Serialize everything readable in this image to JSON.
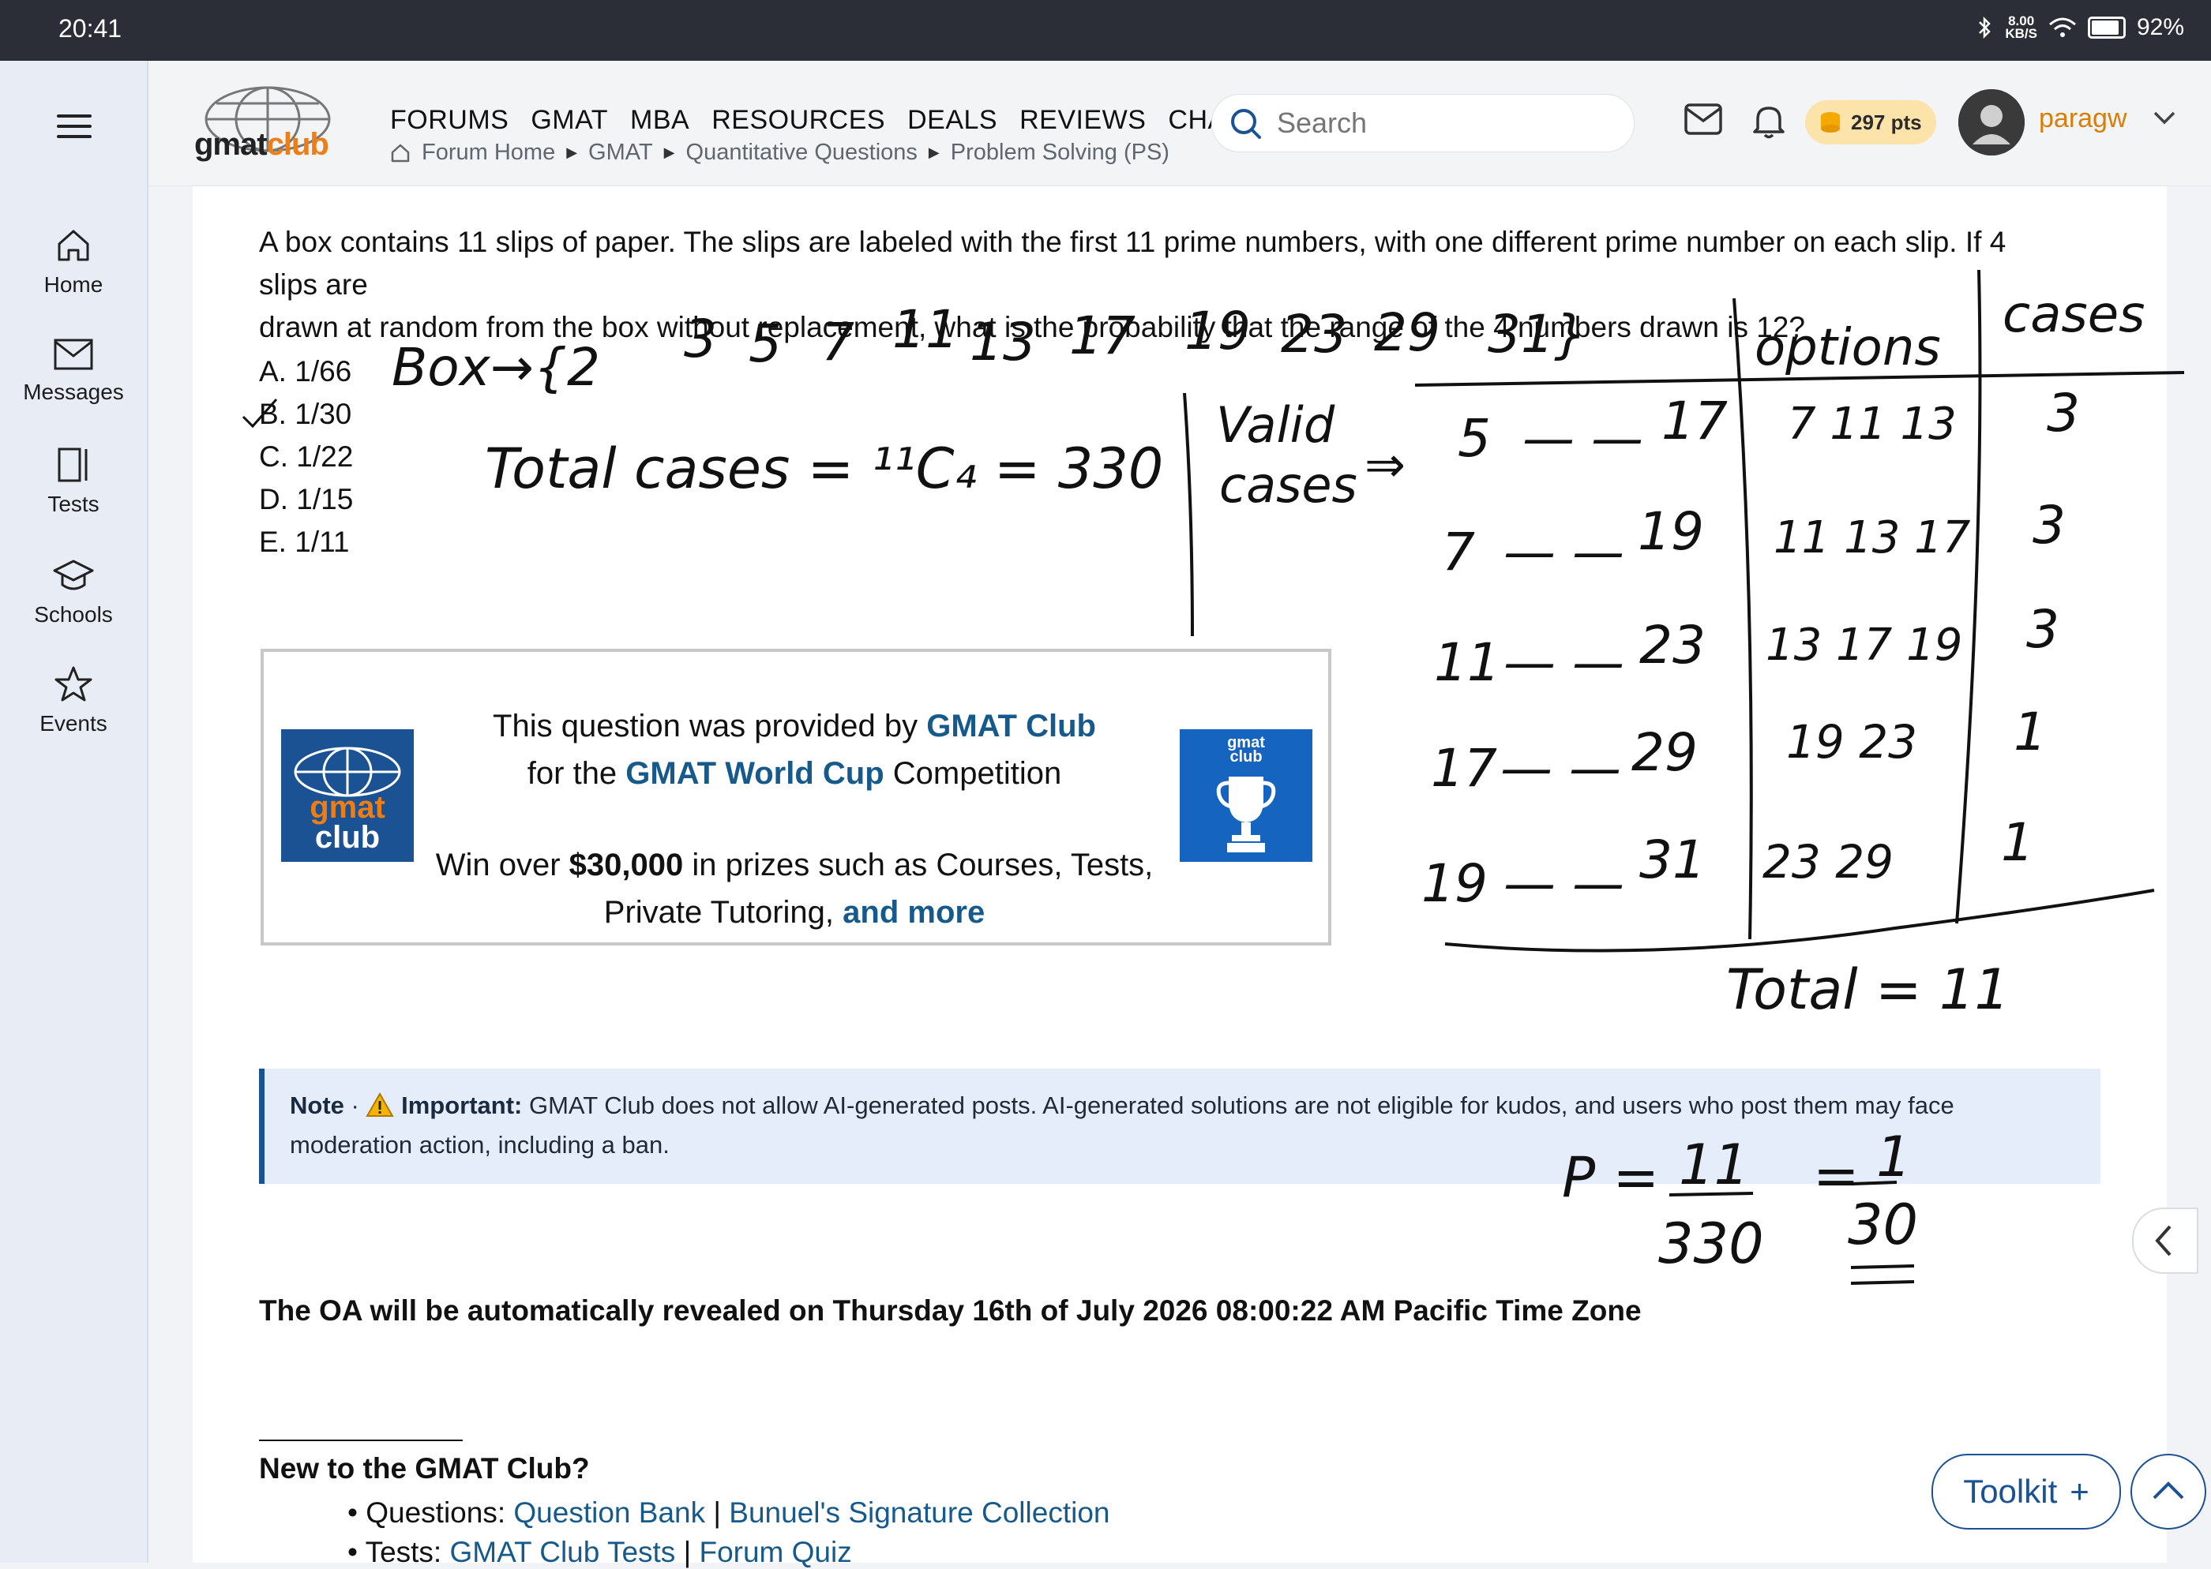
{
  "status_bar": {
    "time": "20:41",
    "speed_value": "8.00",
    "speed_unit": "KB/S",
    "battery": "92%"
  },
  "sidebar": {
    "items": [
      {
        "label": "Home",
        "icon": "home-icon"
      },
      {
        "label": "Messages",
        "icon": "mail-icon"
      },
      {
        "label": "Tests",
        "icon": "tests-icon"
      },
      {
        "label": "Schools",
        "icon": "graduation-cap-icon"
      },
      {
        "label": "Events",
        "icon": "star-icon"
      }
    ]
  },
  "header": {
    "logo_text": {
      "part1": "gmat",
      "part2": "club"
    },
    "menu": [
      "FORUMS",
      "GMAT",
      "MBA",
      "RESOURCES",
      "DEALS",
      "REVIEWS",
      "CHAT"
    ],
    "breadcrumbs": [
      "Forum Home",
      "GMAT",
      "Quantitative Questions",
      "Problem Solving (PS)"
    ],
    "search_placeholder": "Search",
    "points": "297 pts",
    "username": "paragw"
  },
  "question": {
    "text_line1": "A box contains 11 slips of paper. The slips are labeled with the first 11 prime numbers, with one different prime number on each slip. If 4 slips are",
    "text_line2": "drawn at random from the box without replacement, what is the probability that the range of the 4 numbers drawn is 12?",
    "options": [
      "A. 1/66",
      "B. 1/30",
      "C. 1/22",
      "D. 1/15",
      "E. 1/11"
    ]
  },
  "promo": {
    "line1_prefix": "This question was provided by ",
    "line1_link": "GMAT Club",
    "line2_prefix": "for the ",
    "line2_link": "GMAT World Cup",
    "line2_suffix": " Competition",
    "line3_prefix": "Win over ",
    "line3_bold": "$30,000",
    "line3_suffix": " in prizes such as Courses, Tests,",
    "line4_prefix": "Private Tutoring, ",
    "line4_link": "and more",
    "right_logo_text": {
      "part1": "gmat",
      "part2": "club"
    }
  },
  "note": {
    "label": "Note",
    "separator": " · ",
    "warning_icon": "warning-icon",
    "important": "Important:",
    "text": " GMAT Club does not allow AI-generated posts. AI-generated solutions are not eligible for kudos, and users who post them may face moderation action, including a ban."
  },
  "oa_text": "The OA will be automatically revealed on Thursday 16th of July 2026 08:00:22 AM Pacific Time Zone",
  "new_to": {
    "heading": "New to the GMAT Club?",
    "questions_label": "• Questions: ",
    "questions_links": [
      "Question Bank",
      "Bunuel's Signature Collection"
    ],
    "tests_label": "• Tests: ",
    "tests_links": [
      "GMAT Club Tests",
      "Forum Quiz"
    ],
    "divider": " | "
  },
  "handwriting": {
    "box": [
      "Box→{2",
      "3",
      "5",
      "7",
      "11",
      "13",
      "17",
      "19",
      "23",
      "29",
      "31}"
    ],
    "total_cases": "Total cases = ¹¹C₄ = 330",
    "valid_line1": "Valid",
    "valid_line2": "cases",
    "arrow": "⇒",
    "headers": [
      "options",
      "cases"
    ],
    "rows": [
      {
        "first": "5",
        "last": "17",
        "options": "7  11  13",
        "cases": "3"
      },
      {
        "first": "7",
        "last": "19",
        "options": "11 13  17",
        "cases": "3"
      },
      {
        "first": "11",
        "last": "23",
        "options": "13  17  19",
        "cases": "3"
      },
      {
        "first": "17",
        "last": "29",
        "options": "19  23",
        "cases": "1"
      },
      {
        "first": "19",
        "last": "31",
        "options": "23   29",
        "cases": "1"
      }
    ],
    "dash": "— —",
    "total": "Total = 11",
    "prob_label": "P =",
    "num1": "11",
    "den1": "330",
    "equals": "=",
    "num2": "1",
    "den2": "30"
  },
  "toolkit": {
    "label": "Toolkit",
    "plus": "+"
  },
  "colors": {
    "accent": "#1a5293",
    "username": "#d6800a",
    "link": "#165a8c",
    "note_bg": "#e4edf9"
  }
}
